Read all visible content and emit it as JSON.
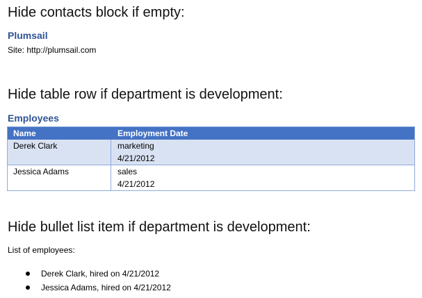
{
  "section1": {
    "heading": "Hide contacts block if empty:",
    "company": "Plumsail",
    "site": "Site: http://plumsail.com"
  },
  "section2": {
    "heading": "Hide table row if department is development:",
    "table_title": "Employees",
    "columns": [
      "Name",
      "Employment Date"
    ],
    "rows": [
      {
        "name": "Derek Clark",
        "department": "marketing",
        "date": "4/21/2012"
      },
      {
        "name": "Jessica Adams",
        "department": "sales",
        "date": "4/21/2012"
      }
    ]
  },
  "section3": {
    "heading": "Hide bullet list item if department is development:",
    "intro": "List of employees:",
    "items": [
      "Derek Clark, hired on 4/21/2012",
      "Jessica Adams, hired on 4/21/2012"
    ]
  },
  "colors": {
    "heading_accent": "#2f5496",
    "table_header": "#4472c4",
    "table_row_alt": "#d9e2f3",
    "table_border": "#8eaadb"
  }
}
